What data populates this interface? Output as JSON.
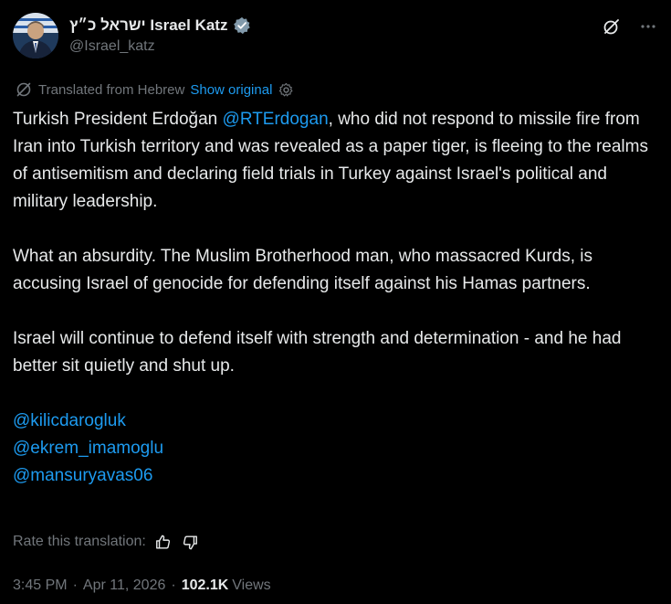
{
  "author": {
    "display_name": "ישראל כ״ץ Israel Katz",
    "handle": "@Israel_katz"
  },
  "header_icons": [
    "grok-icon",
    "more-icon"
  ],
  "translation": {
    "label": "Translated from Hebrew",
    "show_original": "Show original"
  },
  "tweet": {
    "p1_before": "Turkish President Erdoğan ",
    "p1_mention": "@RTErdogan",
    "p1_after": ", who did not respond to missile fire from Iran into Turkish territory and was revealed as a paper tiger, is fleeing to the realms of antisemitism and declaring field trials in Turkey against Israel's political and military leadership.",
    "p2": "What an absurdity. The Muslim Brotherhood man, who massacred Kurds, is accusing Israel of genocide for defending itself against his Hamas partners.",
    "p3": "Israel will continue to defend itself with strength and determination - and he had better sit quietly and shut up.",
    "mentions": [
      "@kilicdarogluk",
      "@ekrem_imamoglu",
      "@mansuryavas06"
    ]
  },
  "rate_translation": {
    "label": "Rate this translation:"
  },
  "meta": {
    "time": "3:45 PM",
    "dot": "·",
    "date": "Apr 11, 2026",
    "views_count": "102.1K",
    "views_label": "Views"
  },
  "colors": {
    "background": "#000000",
    "text": "#e7e9ea",
    "secondary": "#71767b",
    "link": "#1d9bf0"
  }
}
